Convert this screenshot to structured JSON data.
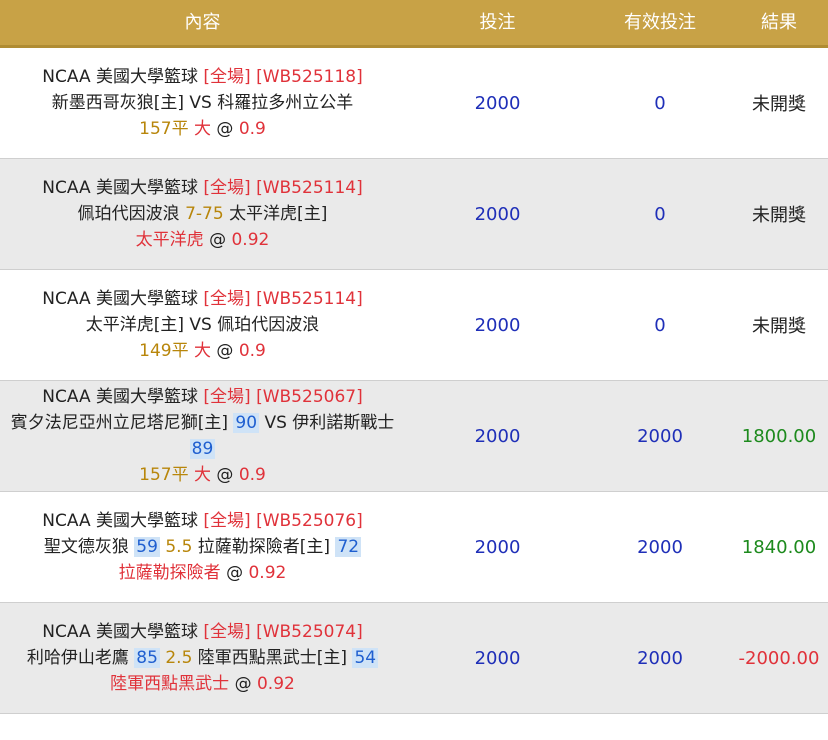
{
  "header": {
    "content": "內容",
    "bet": "投注",
    "valid_bet": "有效投注",
    "result": "結果"
  },
  "rows": [
    {
      "league": "NCAA 美國大學籃球",
      "period": "[全場]",
      "code": "[WB525118]",
      "home_team": "新墨西哥灰狼[主]",
      "vs": "VS",
      "away_team": "科羅拉多州立公羊",
      "line": "157平",
      "pick": "大",
      "at": "@",
      "odds": "0.9",
      "bet": "2000",
      "valid_bet": "0",
      "result": "未開獎"
    },
    {
      "league": "NCAA 美國大學籃球",
      "period": "[全場]",
      "code": "[WB525114]",
      "team_a": "佩珀代因波浪",
      "handicap": "7-75",
      "team_b": "太平洋虎[主]",
      "pick": "太平洋虎",
      "at": "@",
      "odds": "0.92",
      "bet": "2000",
      "valid_bet": "0",
      "result": "未開獎"
    },
    {
      "league": "NCAA 美國大學籃球",
      "period": "[全場]",
      "code": "[WB525114]",
      "home_team": "太平洋虎[主]",
      "vs": "VS",
      "away_team": "佩珀代因波浪",
      "line": "149平",
      "pick": "大",
      "at": "@",
      "odds": "0.9",
      "bet": "2000",
      "valid_bet": "0",
      "result": "未開獎"
    },
    {
      "league": "NCAA 美國大學籃球",
      "period": "[全場]",
      "code": "[WB525067]",
      "home_team": "賓夕法尼亞州立尼塔尼獅[主]",
      "home_score": "90",
      "vs": "VS",
      "away_team": "伊利諾斯戰士",
      "away_score": "89",
      "line": "157平",
      "pick": "大",
      "at": "@",
      "odds": "0.9",
      "bet": "2000",
      "valid_bet": "2000",
      "result": "1800.00"
    },
    {
      "league": "NCAA 美國大學籃球",
      "period": "[全場]",
      "code": "[WB525076]",
      "team_a": "聖文德灰狼",
      "score_a": "59",
      "handicap": "5.5",
      "team_b": "拉薩勒探險者[主]",
      "score_b": "72",
      "pick": "拉薩勒探險者",
      "at": "@",
      "odds": "0.92",
      "bet": "2000",
      "valid_bet": "2000",
      "result": "1840.00"
    },
    {
      "league": "NCAA 美國大學籃球",
      "period": "[全場]",
      "code": "[WB525074]",
      "team_a": "利哈伊山老鷹",
      "score_a": "85",
      "handicap": "2.5",
      "team_b": "陸軍西點黑武士[主]",
      "score_b": "54",
      "pick": "陸軍西點黑武士",
      "at": "@",
      "odds": "0.92",
      "bet": "2000",
      "valid_bet": "2000",
      "result": "-2000.00"
    }
  ],
  "colors": {
    "header_bg": "#c8a246",
    "alt_row_bg": "#eaeaea",
    "highlight": "#e0323a",
    "gold": "#b8860b",
    "blue": "#1f2fb8",
    "win": "#1d8a1d"
  }
}
